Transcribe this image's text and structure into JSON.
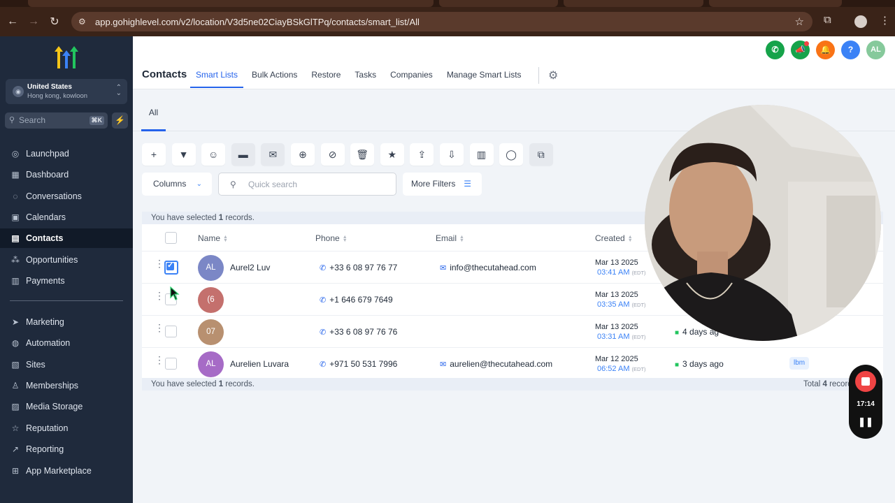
{
  "browser": {
    "url": "app.gohighlevel.com/v2/location/V3d5ne02CiayBSkGlTPq/contacts/smart_list/All",
    "account_avatar": "profile-icon"
  },
  "sidebar": {
    "location": {
      "name": "United States",
      "sub": "Hong kong, kowloon"
    },
    "search": {
      "placeholder": "Search",
      "shortcut": "⌘K"
    },
    "items": [
      {
        "label": "Launchpad",
        "icon": "rocket-icon"
      },
      {
        "label": "Dashboard",
        "icon": "grid-icon"
      },
      {
        "label": "Conversations",
        "icon": "chat-icon"
      },
      {
        "label": "Calendars",
        "icon": "calendar-icon"
      },
      {
        "label": "Contacts",
        "icon": "contacts-icon",
        "active": true
      },
      {
        "label": "Opportunities",
        "icon": "opportunities-icon"
      },
      {
        "label": "Payments",
        "icon": "payments-icon"
      },
      {
        "label": "Marketing",
        "icon": "send-icon"
      },
      {
        "label": "Automation",
        "icon": "automation-icon"
      },
      {
        "label": "Sites",
        "icon": "sites-icon"
      },
      {
        "label": "Memberships",
        "icon": "memberships-icon"
      },
      {
        "label": "Media Storage",
        "icon": "media-icon"
      },
      {
        "label": "Reputation",
        "icon": "star-icon"
      },
      {
        "label": "Reporting",
        "icon": "chart-icon"
      },
      {
        "label": "App Marketplace",
        "icon": "apps-icon"
      }
    ]
  },
  "header": {
    "title": "Contacts",
    "tabs": [
      "Smart Lists",
      "Bulk Actions",
      "Restore",
      "Tasks",
      "Companies",
      "Manage Smart Lists"
    ],
    "active_tab": "Smart Lists",
    "avatar_initials": "AL",
    "colors": {
      "phone": "#16a34a",
      "megaphone": "#16a34a",
      "bell": "#f97316",
      "help": "#3b82f6",
      "avatar": "#86c99b"
    }
  },
  "subtabs": {
    "active": "All"
  },
  "toolbar": {
    "icons": [
      "plus-icon",
      "filter-icon",
      "bot-icon",
      "message-icon",
      "email-icon",
      "tag-add-icon",
      "tag-remove-icon",
      "trash-icon",
      "star-icon",
      "export-icon",
      "import-icon",
      "building-icon",
      "whatsapp-icon",
      "duplicate-icon"
    ]
  },
  "controls": {
    "columns_label": "Columns",
    "search_placeholder": "Quick search",
    "more_filters_label": "More Filters"
  },
  "selection": {
    "prefix": "You have selected ",
    "count": "1",
    "suffix": " records."
  },
  "table": {
    "headers": {
      "name": "Name",
      "phone": "Phone",
      "email": "Email",
      "created": "Created"
    },
    "rows": [
      {
        "checked": true,
        "initials": "AL",
        "avatar_color": "#7b87c6",
        "name": "Aurel2 Luv",
        "phone": "+33 6 08 97 76 77",
        "email": "info@thecutahead.com",
        "date": "Mar 13 2025",
        "time": "03:41 AM",
        "tz": "(EDT)",
        "activity": "",
        "tag": ""
      },
      {
        "checked": false,
        "initials": "(6",
        "avatar_color": "#c4706d",
        "name": "",
        "phone": "+1 646 679 7649",
        "email": "",
        "date": "Mar 13 2025",
        "time": "03:35 AM",
        "tz": "(EDT)",
        "activity": "",
        "tag": ""
      },
      {
        "checked": false,
        "initials": "07",
        "avatar_color": "#b89070",
        "name": "",
        "phone": "+33 6 08 97 76 76",
        "email": "",
        "date": "Mar 13 2025",
        "time": "03:31 AM",
        "tz": "(EDT)",
        "activity": "4 days ag",
        "tag": ""
      },
      {
        "checked": false,
        "initials": "AL",
        "avatar_color": "#a66bc6",
        "name": "Aurelien Luvara",
        "phone": "+971 50 531 7996",
        "email": "aurelien@thecutahead.com",
        "date": "Mar 12 2025",
        "time": "06:52 AM",
        "tz": "(EDT)",
        "activity": "3 days ago",
        "tag": "lbm"
      }
    ]
  },
  "footer": {
    "total_prefix": "Total ",
    "total": "4",
    "total_suffix": " records | 1 of "
  },
  "recorder": {
    "time": "17:14"
  }
}
